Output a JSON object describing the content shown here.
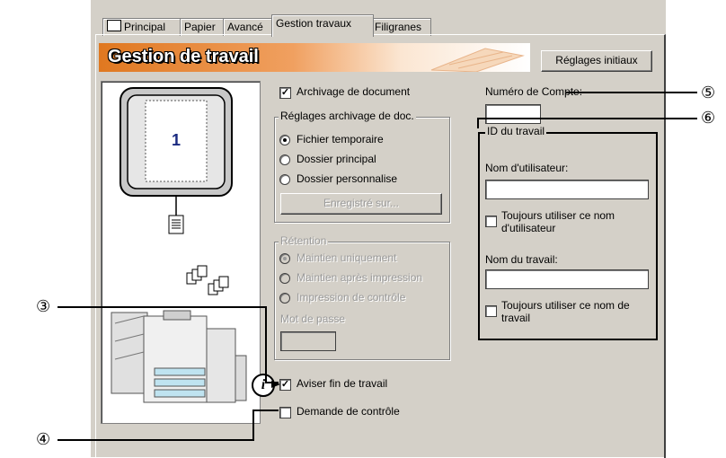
{
  "tabs": [
    "Principal",
    "Papier",
    "Avancé",
    "Gestion travaux",
    "Filigranes"
  ],
  "banner": {
    "title": "Gestion de travail",
    "reset_button": "Réglages initiaux"
  },
  "preview": {
    "page_number": "1"
  },
  "archive": {
    "checkbox_label": "Archivage de document",
    "checked": true,
    "group_title": "Réglages archivage de doc.",
    "options": [
      "Fichier temporaire",
      "Dossier principal",
      "Dossier personnalise"
    ],
    "selected_index": 0,
    "save_button": "Enregistré sur..."
  },
  "retention": {
    "group_title": "Rétention",
    "options": [
      "Maintien uniquement",
      "Maintien après impression",
      "Impression de contrôle"
    ],
    "selected_index": 0,
    "password_label": "Mot de passe",
    "password_value": ""
  },
  "notify": {
    "label": "Aviser fin de travail",
    "checked": true
  },
  "confirm": {
    "label": "Demande de contrôle",
    "checked": false
  },
  "account": {
    "label": "Numéro de Compte:",
    "value": ""
  },
  "job_id": {
    "group_title": "ID du travail",
    "user_label": "Nom d'utilisateur:",
    "user_value": "",
    "always_user": "Toujours utiliser ce nom d'utilisateur",
    "job_label": "Nom du travail:",
    "job_value": "",
    "always_job": "Toujours utiliser ce nom de travail"
  },
  "callouts": [
    "③",
    "④",
    "⑤",
    "⑥"
  ],
  "icons": {
    "printer_tab": "printer-icon",
    "info": "info-icon"
  }
}
